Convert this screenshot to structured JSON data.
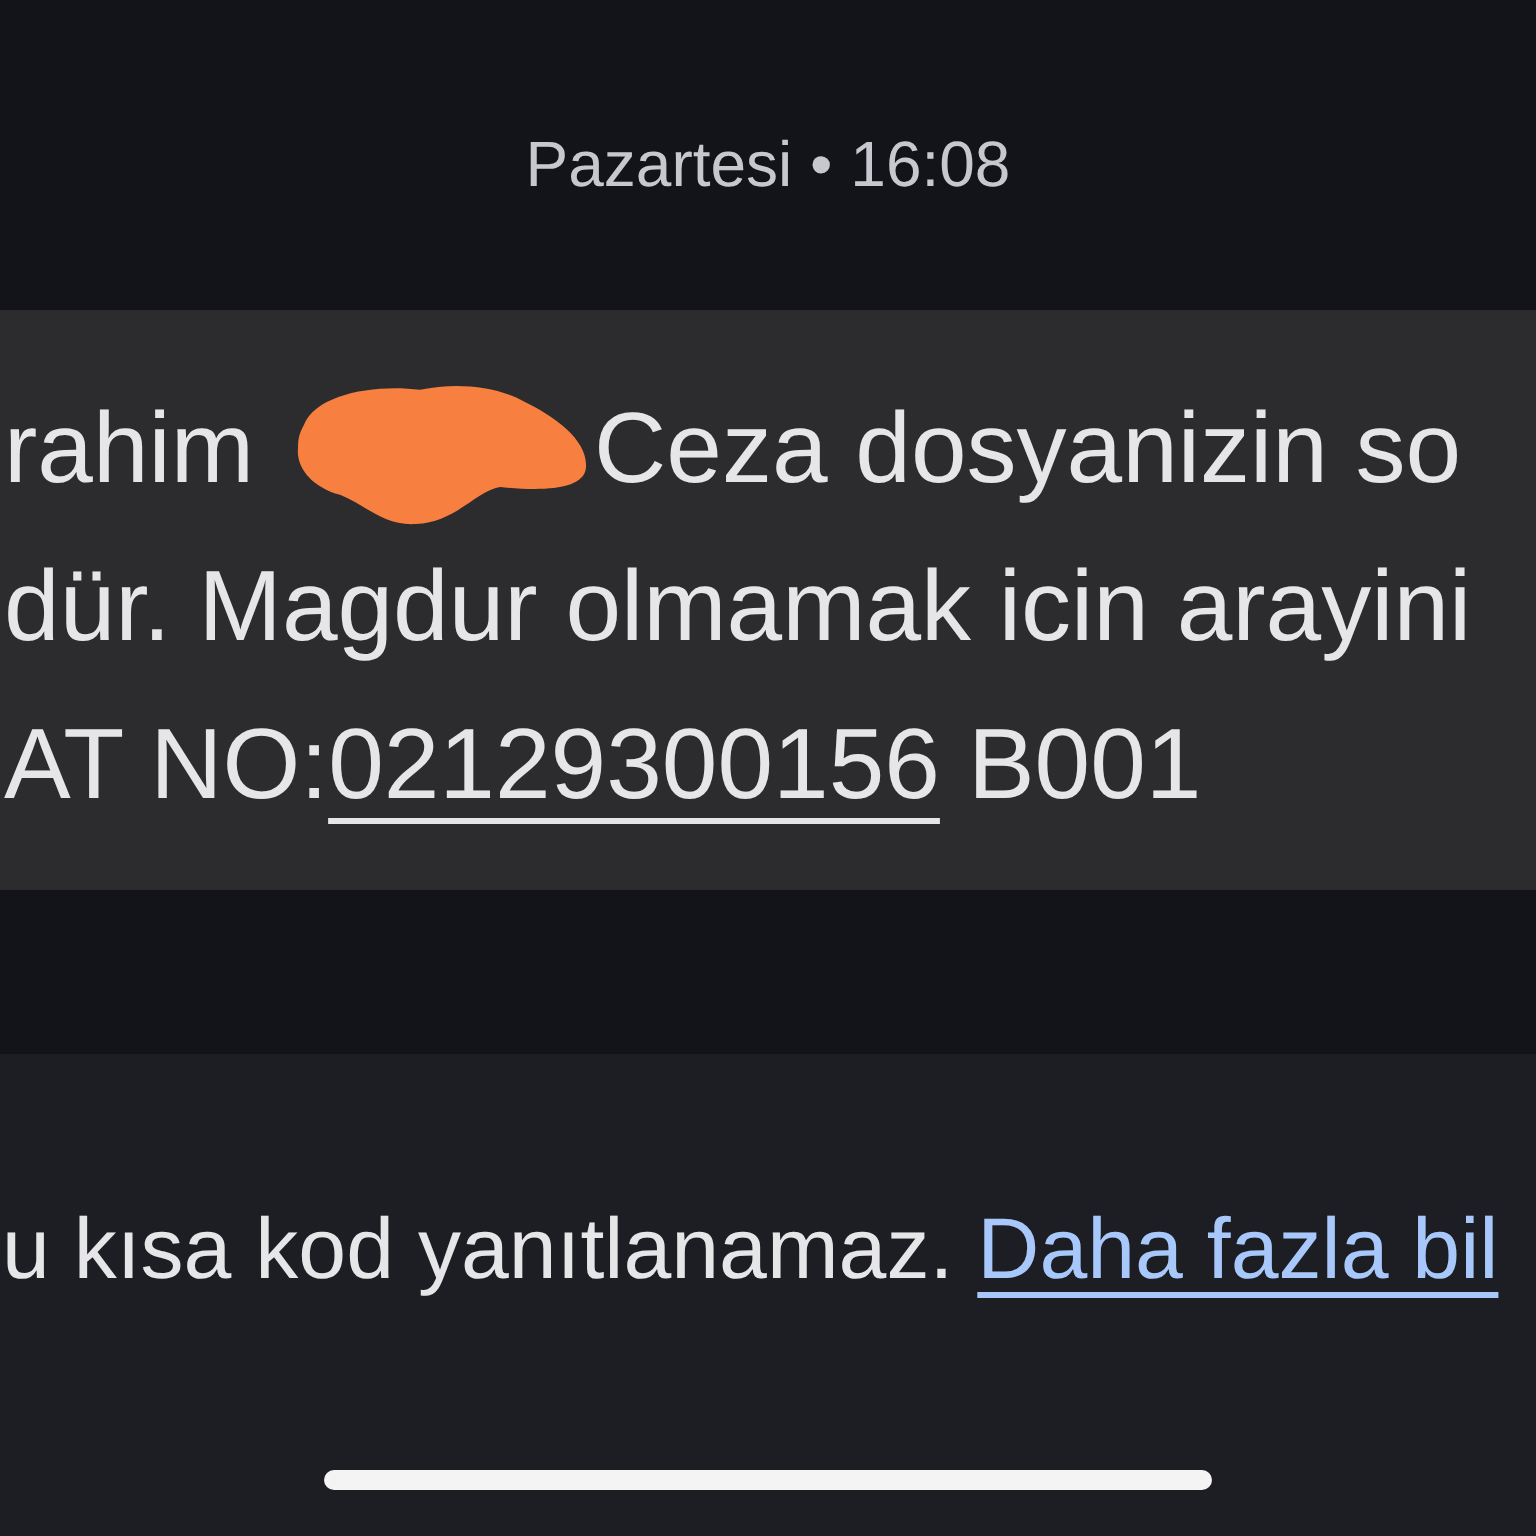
{
  "timestamp": "Pazartesi • 16:08",
  "message": {
    "lines": [
      [
        {
          "kind": "text",
          "text": "rahim"
        },
        {
          "kind": "redaction"
        },
        {
          "kind": "text",
          "text": "Ceza dosyanizin so"
        }
      ],
      [
        {
          "kind": "text",
          "text": "dür. Magdur olmamak icin arayini"
        }
      ],
      [
        {
          "kind": "text",
          "text": "AT NO:"
        },
        {
          "kind": "link",
          "text": "02129300156"
        },
        {
          "kind": "text",
          "text": "B001"
        }
      ]
    ]
  },
  "footer": {
    "notice": "u kısa kod yanıtlanamaz.",
    "link": "Daha fazla bil"
  }
}
